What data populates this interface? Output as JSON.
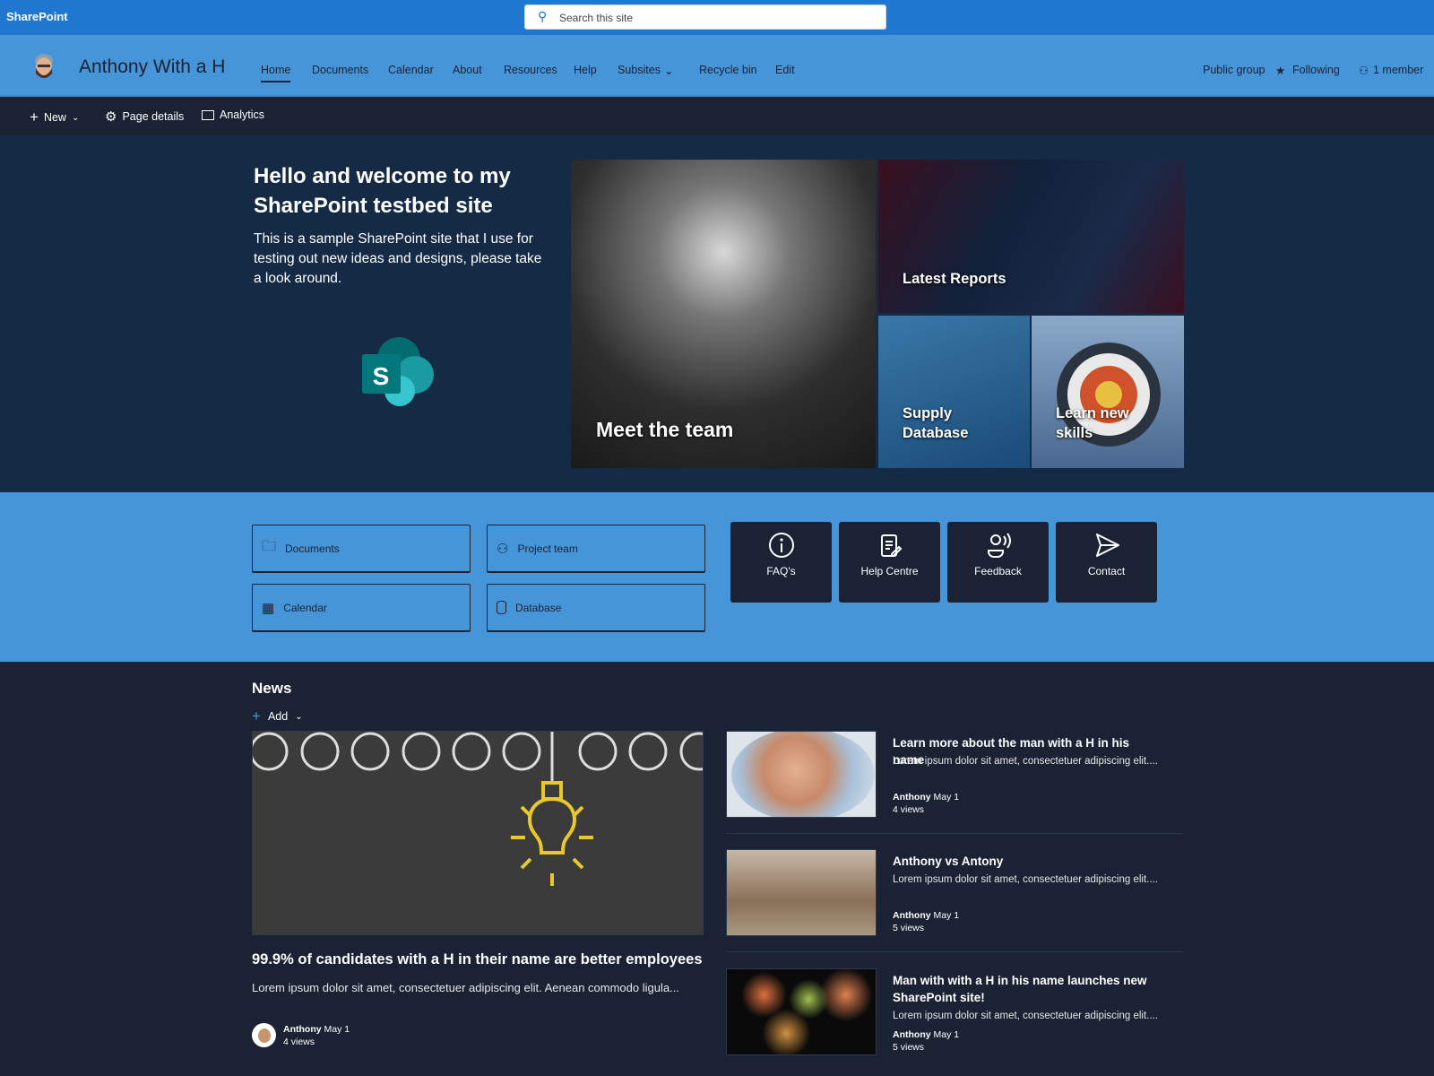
{
  "topbar": {
    "app": "SharePoint",
    "search_placeholder": "Search this site"
  },
  "site": {
    "name": "Anthony With a H",
    "nav": [
      "Home",
      "Documents",
      "Calendar",
      "About",
      "Resources",
      "Help",
      "Subsites",
      "Recycle bin",
      "Edit"
    ],
    "public": "Public group",
    "following": "Following",
    "members": "1 member"
  },
  "command": {
    "new": "New",
    "page_details": "Page details",
    "analytics": "Analytics"
  },
  "hero": {
    "title": "Hello and welcome to my SharePoint testbed site",
    "description": "This is a sample SharePoint site that I use for testing out new ideas and designs, please take a look around.",
    "logo_letter": "S",
    "tiles": [
      "Meet the team",
      "Latest Reports",
      "Supply Database",
      "Learn new skills"
    ]
  },
  "quick_links": {
    "buttons": [
      "Documents",
      "Project team",
      "Calendar",
      "Database"
    ],
    "tiles": [
      "FAQ's",
      "Help Centre",
      "Feedback",
      "Contact"
    ]
  },
  "news": {
    "title": "News",
    "add": "Add",
    "featured": {
      "title": "99.9% of candidates with a H in their name are better employees",
      "description": "Lorem ipsum dolor sit amet, consectetuer adipiscing elit. Aenean commodo ligula...",
      "author": "Anthony",
      "date": "May 1",
      "views": "4 views"
    },
    "items": [
      {
        "title": "Learn more about the man with a H in his name",
        "description": "Lorem ipsum dolor sit amet, consectetuer adipiscing elit....",
        "author": "Anthony",
        "date": "May 1",
        "views": "4 views"
      },
      {
        "title": "Anthony vs Antony",
        "description": "Lorem ipsum dolor sit amet, consectetuer adipiscing elit....",
        "author": "Anthony",
        "date": "May 1",
        "views": "5 views"
      },
      {
        "title": "Man with with a H in his name launches new SharePoint site!",
        "description": "Lorem ipsum dolor sit amet, consectetuer adipiscing elit....",
        "author": "Anthony",
        "date": "May 1",
        "views": "5 views"
      }
    ]
  },
  "colors": {
    "topbar": "#2077d0",
    "nav": "#4795d9",
    "dark": "#1a2233",
    "hero": "#152b45"
  }
}
